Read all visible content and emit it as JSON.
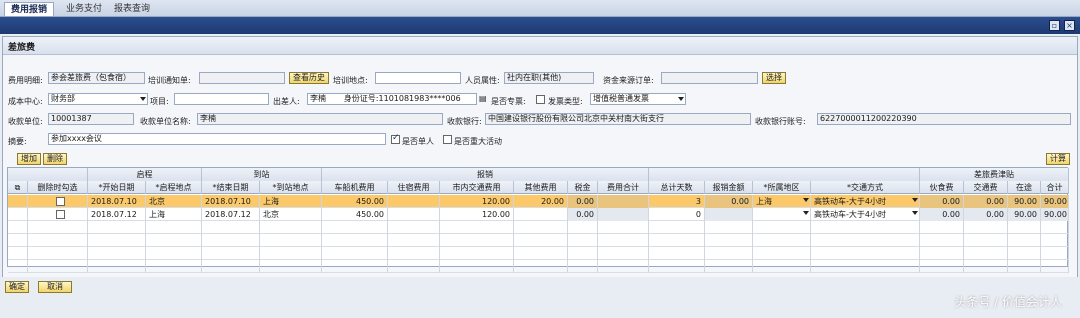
{
  "tabs": [
    "费用报销",
    "业务支付",
    "报表查询"
  ],
  "panel": {
    "title": "差旅费"
  },
  "form": {
    "expense_detail_label": "费用明细:",
    "expense_detail_value": "参会差旅费（包食宿）",
    "training_notice_label": "培训通知单:",
    "training_notice_value": "",
    "view_history": "查看历史",
    "training_place_label": "培训地点:",
    "training_place_value": "",
    "person_attr_label": "人员属性:",
    "person_attr_value": "社内在职(其他)",
    "fund_source_label": "资金来源订单:",
    "fund_source_value": "",
    "select_btn": "选择",
    "cost_center_label": "成本中心:",
    "cost_center_value": "财务部",
    "project_label": "项目:",
    "project_value": "",
    "traveler_label": "出差人:",
    "traveler_value": "李楠",
    "id_label": "身份证号:",
    "id_value": "1101081983****006",
    "special_ticket_label": "是否专票:",
    "invoice_type_label": "发票类型:",
    "invoice_type_value": "增值税普通发票",
    "payee_unit_label": "收款单位:",
    "payee_unit_value": "10001387",
    "payee_name_label": "收款单位名称:",
    "payee_name_value": "李楠",
    "bank_label": "收款银行:",
    "bank_value": "中国建设银行股份有限公司北京中关村南大街支行",
    "account_label": "收款银行账号:",
    "account_value": "6227000011200220390",
    "summary_label": "摘要:",
    "summary_value": "参加xxxx会议",
    "single_person_label": "是否单人",
    "major_event_label": "是否重大活动"
  },
  "toolbar": {
    "add": "增加",
    "delete": "删除",
    "calc": "计算"
  },
  "table": {
    "groups": [
      "启程",
      "到站",
      "报销",
      "差旅费津贴"
    ],
    "headers": [
      "删除时勾选",
      "*开始日期",
      "*启程地点",
      "*结束日期",
      "*到站地点",
      "车船机费用",
      "住宿费用",
      "市内交通费用",
      "其他费用",
      "税金",
      "费用合计",
      "总计天数",
      "报销金额",
      "*所属地区",
      "*交通方式",
      "伙食费",
      "交通费",
      "在途",
      "合计"
    ],
    "rows": [
      [
        "",
        "2018.07.10",
        "北京",
        "2018.07.10",
        "上海",
        "450.00",
        "",
        "120.00",
        "20.00",
        "0.00",
        "",
        "3",
        "0.00",
        "上海",
        "高铁动车-大于4小时",
        "0.00",
        "0.00",
        "90.00",
        "90.00"
      ],
      [
        "",
        "2018.07.12",
        "上海",
        "2018.07.12",
        "北京",
        "450.00",
        "",
        "120.00",
        "",
        "0.00",
        "",
        "0",
        "",
        "",
        "高铁动车-大于4小时",
        "0.00",
        "0.00",
        "90.00",
        "90.00"
      ]
    ]
  },
  "footer": {
    "ok": "确定",
    "cancel": "取消"
  },
  "watermark": "头条号 / 价值会计人"
}
